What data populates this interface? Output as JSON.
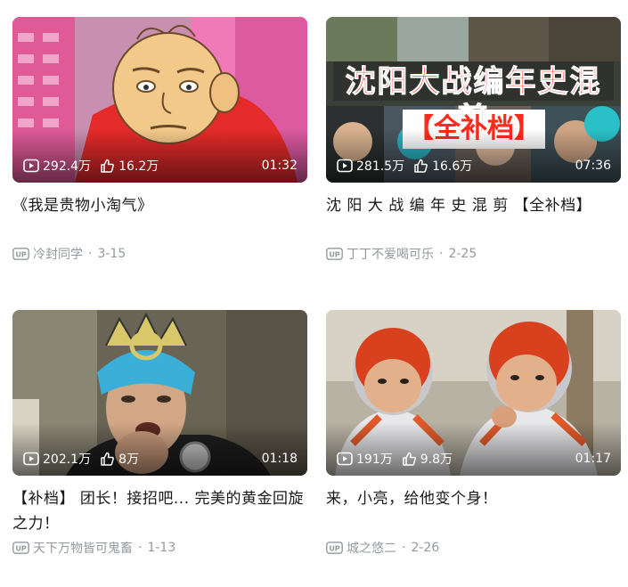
{
  "videos": [
    {
      "views": "292.4万",
      "likes": "16.2万",
      "duration": "01:32",
      "title": "《我是贵物小淘气》",
      "author": "冷封同学",
      "date": "3-15"
    },
    {
      "views": "281.5万",
      "likes": "16.6万",
      "duration": "07:36",
      "title": "沈 阳 大 战 编 年 史 混 剪 【全补档】",
      "author": "丁丁不爱喝可乐",
      "date": "2-25",
      "thumb_text_1": "沈阳大战编年史混剪",
      "thumb_text_2": "【全补档】"
    },
    {
      "views": "202.1万",
      "likes": "8万",
      "duration": "01:18",
      "title": "【补档】 团长！接招吧... 完美的黄金回旋之力！",
      "author": "天下万物皆可鬼畜",
      "date": "1-13"
    },
    {
      "views": "191万",
      "likes": "9.8万",
      "duration": "01:17",
      "title": "来，小亮，给他变个身！",
      "author": "城之悠二",
      "date": "2-26"
    }
  ],
  "icons": {
    "views": "play-count-icon",
    "likes": "thumbs-up-icon",
    "uploader": "up-badge-icon"
  },
  "colors": {
    "meta": "#9499a0",
    "title": "#18191c"
  }
}
